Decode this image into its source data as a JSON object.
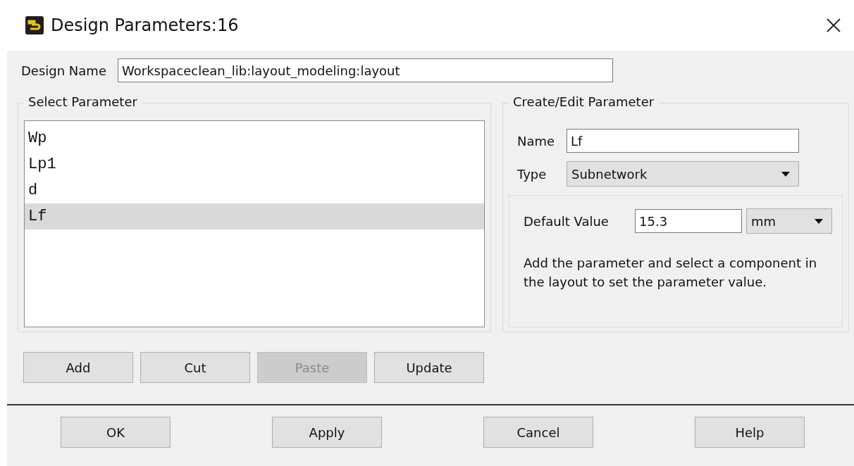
{
  "window": {
    "title": "Design Parameters:16"
  },
  "design_name": {
    "label": "Design Name",
    "value": "Workspaceclean_lib:layout_modeling:layout"
  },
  "select_parameter": {
    "title": "Select Parameter",
    "items": [
      {
        "label": "Wp",
        "selected": false
      },
      {
        "label": "Lp1",
        "selected": false
      },
      {
        "label": "d",
        "selected": false
      },
      {
        "label": "Lf",
        "selected": true
      }
    ]
  },
  "create_edit": {
    "title": "Create/Edit Parameter",
    "name_label": "Name",
    "name_value": "Lf",
    "type_label": "Type",
    "type_value": "Subnetwork",
    "default_label": "Default Value",
    "default_value": "15.3",
    "unit": "mm",
    "hint": "Add the parameter and select a component in the layout to set the parameter value."
  },
  "list_buttons": [
    {
      "label": "Add",
      "disabled": false
    },
    {
      "label": "Cut",
      "disabled": false
    },
    {
      "label": "Paste",
      "disabled": true
    },
    {
      "label": "Update",
      "disabled": false
    }
  ],
  "dialog_buttons": [
    "OK",
    "Apply",
    "Cancel",
    "Help"
  ]
}
